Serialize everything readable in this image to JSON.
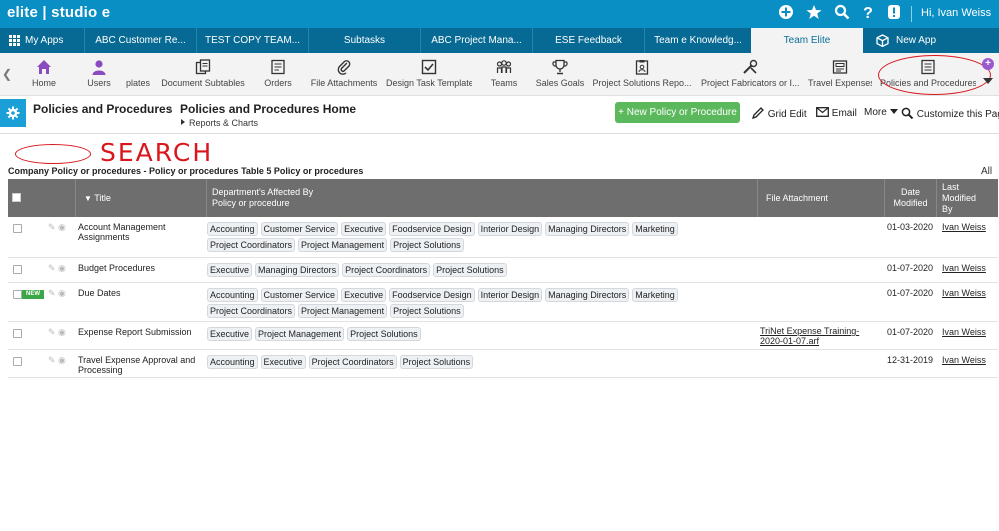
{
  "topbar": {
    "brand": "elite | studio e",
    "greeting": "Hi, Ivan Weiss",
    "icons": [
      "add-icon",
      "star-icon",
      "search-icon",
      "help-icon",
      "alert-icon"
    ]
  },
  "app_tabs": [
    {
      "label": "My Apps"
    },
    {
      "label": "ABC Customer Re..."
    },
    {
      "label": "TEST COPY TEAM..."
    },
    {
      "label": "Subtasks"
    },
    {
      "label": "ABC Project Mana..."
    },
    {
      "label": "ESE Feedback"
    },
    {
      "label": "Team e Knowledg..."
    },
    {
      "label": "Team Elite"
    },
    {
      "label": "New App"
    }
  ],
  "subnav": [
    {
      "label": "Home",
      "icon": "home-icon"
    },
    {
      "label": "Users",
      "icon": "user-icon"
    },
    {
      "label": "plates",
      "icon": ""
    },
    {
      "label": "Document Subtables",
      "icon": "document-icon"
    },
    {
      "label": "Orders",
      "icon": "orders-icon"
    },
    {
      "label": "File Attachments",
      "icon": "paperclip-icon"
    },
    {
      "label": "Design Task Template",
      "icon": "checkbox-icon"
    },
    {
      "label": "Teams",
      "icon": "team-icon"
    },
    {
      "label": "Sales Goals",
      "icon": "trophy-icon"
    },
    {
      "label": "Project Solutions Repo...",
      "icon": "report-icon"
    },
    {
      "label": "Project Fabricators or I...",
      "icon": "tools-icon"
    },
    {
      "label": "Travel Expenses",
      "icon": "expenses-icon"
    },
    {
      "label": "Policies and Procedures",
      "icon": "list-icon"
    }
  ],
  "header": {
    "app_crumb": "Policies and Procedures",
    "page_title": "Policies and Procedures Home",
    "sub_crumb": "Reports & Charts",
    "new_button": "+ New Policy or Procedure",
    "grid_edit": "Grid Edit",
    "email": "Email",
    "more": "More",
    "customize": "Customize this Page"
  },
  "annotation": {
    "search_word": "SEARCH"
  },
  "table": {
    "caption": "Company Policy or procedures - Policy or procedures Table 5 Policy or procedures",
    "all_link": "All",
    "columns": [
      "Title",
      "Department's Affected By Policy or procedure",
      "File Attachment",
      "Date Modified",
      "Last Modified By"
    ],
    "rows": [
      {
        "title": "Account Management Assignments",
        "new": false,
        "depts": [
          "Accounting",
          "Customer Service",
          "Executive",
          "Foodservice Design",
          "Interior Design",
          "Managing Directors",
          "Marketing",
          "Project Coordinators",
          "Project Management",
          "Project Solutions"
        ],
        "attachment": "",
        "date": "01-03-2020",
        "by": "Ivan Weiss"
      },
      {
        "title": "Budget Procedures",
        "new": false,
        "depts": [
          "Executive",
          "Managing Directors",
          "Project Coordinators",
          "Project Solutions"
        ],
        "attachment": "",
        "date": "01-07-2020",
        "by": "Ivan Weiss"
      },
      {
        "title": "Due Dates",
        "new": true,
        "badge": "NEW",
        "depts": [
          "Accounting",
          "Customer Service",
          "Executive",
          "Foodservice Design",
          "Interior Design",
          "Managing Directors",
          "Marketing",
          "Project Coordinators",
          "Project Management",
          "Project Solutions"
        ],
        "attachment": "",
        "date": "01-07-2020",
        "by": "Ivan Weiss"
      },
      {
        "title": "Expense Report Submission",
        "new": false,
        "depts": [
          "Executive",
          "Project Management",
          "Project Solutions"
        ],
        "attachment": "TriNet Expense Training-2020-01-07.arf",
        "date": "01-07-2020",
        "by": "Ivan Weiss"
      },
      {
        "title": "Travel Expense Approval and Processing",
        "new": false,
        "depts": [
          "Accounting",
          "Executive",
          "Project Coordinators",
          "Project Solutions"
        ],
        "attachment": "",
        "date": "12-31-2019",
        "by": "Ivan Weiss"
      }
    ]
  }
}
